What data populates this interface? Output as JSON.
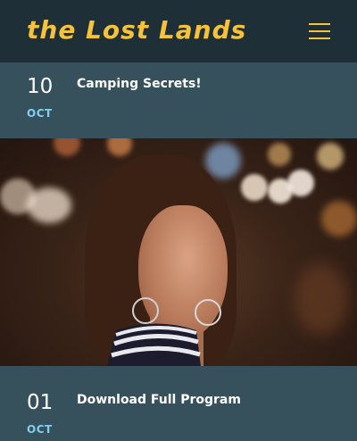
{
  "header": {
    "logo_text": "the Lost Lands",
    "menu_icon": "hamburger-menu-icon",
    "accent_color": "#f6c23a",
    "background_color": "#1f2f38"
  },
  "events": [
    {
      "day": "10",
      "month": "OCT",
      "title": "Camping Secrets!"
    },
    {
      "day": "01",
      "month": "OCT",
      "title": "Download Full Program"
    }
  ],
  "colors": {
    "page_background": "#36505c",
    "month_color": "#7fd1ef"
  }
}
